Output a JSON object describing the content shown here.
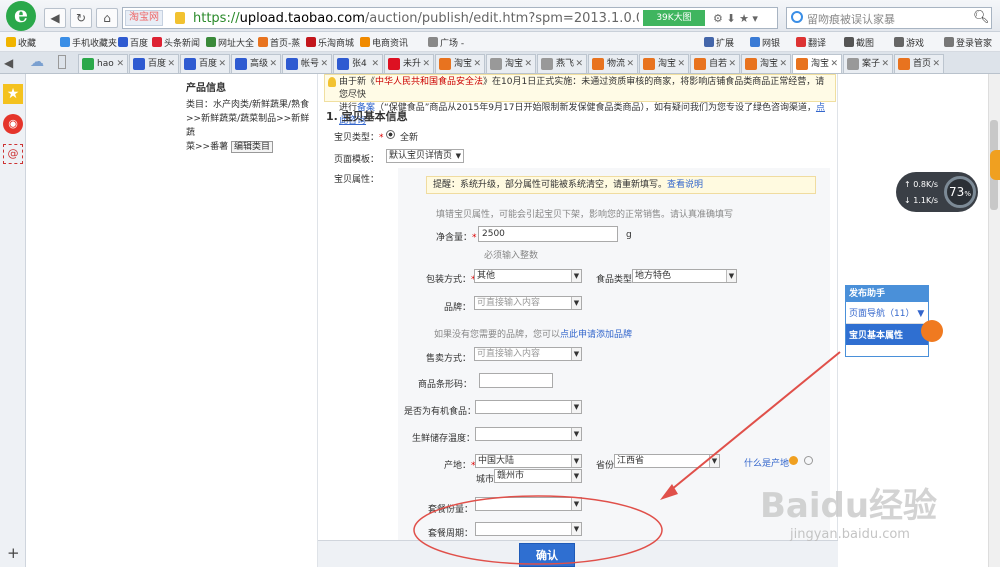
{
  "browser": {
    "site_badge": "淘宝网",
    "url_scheme": "https://",
    "url_host": "upload.taobao.com",
    "url_rest": "/auction/publish/edit.htm?spm=2013.1.0.0.Nm5Swi&item_nu",
    "green_badge": "39K大图",
    "search_placeholder": "留吻痕被误认家暴"
  },
  "favorites": [
    {
      "label": "收藏",
      "color": "#f0b400"
    },
    {
      "label": "手机收藏夹",
      "color": "#3a8ee6"
    },
    {
      "label": "百度",
      "color": "#2f5bd1"
    },
    {
      "label": "头条新闻",
      "color": "#d23"
    },
    {
      "label": "网址大全",
      "color": "#3a8a3a"
    },
    {
      "label": "首页-蒸",
      "color": "#e8731f"
    },
    {
      "label": "乐淘商城",
      "color": "#c3161c"
    },
    {
      "label": "电商资讯",
      "color": "#f08a00"
    },
    {
      "label": "广场 -",
      "color": "#888"
    }
  ],
  "favorites_right": [
    {
      "label": "扩展",
      "color": "#4466aa"
    },
    {
      "label": "网银",
      "color": "#3a7bd5"
    },
    {
      "label": "翻译",
      "color": "#d33"
    },
    {
      "label": "截图",
      "color": "#555"
    },
    {
      "label": "游戏",
      "color": "#666"
    },
    {
      "label": "登录管家",
      "color": "#777"
    }
  ],
  "tabs": [
    {
      "label": "hao",
      "color": "#2aa84a"
    },
    {
      "label": "百度",
      "color": "#2f5bd1"
    },
    {
      "label": "百度",
      "color": "#2f5bd1"
    },
    {
      "label": "高级",
      "color": "#2f5bd1"
    },
    {
      "label": "帐号",
      "color": "#2f5bd1"
    },
    {
      "label": "张4",
      "color": "#2f5bd1"
    },
    {
      "label": "未升",
      "color": "#d12"
    },
    {
      "label": "淘宝",
      "color": "#e8731f"
    },
    {
      "label": "淘宝",
      "color": "#999"
    },
    {
      "label": "燕飞",
      "color": "#999"
    },
    {
      "label": "物流",
      "color": "#e8731f"
    },
    {
      "label": "淘宝",
      "color": "#e8731f"
    },
    {
      "label": "自若",
      "color": "#e8731f"
    },
    {
      "label": "淘宝",
      "color": "#e8731f"
    },
    {
      "label": "淘宝",
      "color": "#e8731f"
    },
    {
      "label": "案子",
      "color": "#999"
    },
    {
      "label": "首页",
      "color": "#e8731f"
    }
  ],
  "left_panel": {
    "title": "产品信息",
    "category_lines": [
      "类目：水产肉类/新鲜蔬果/熟食",
      ">>新鲜蔬菜/蔬菜制品>>新鲜蔬",
      "菜>>番薯"
    ],
    "edit_link": "编辑类目"
  },
  "notice": {
    "line1_prefix": "由于新《",
    "line1_law": "中华人民共和国食品安全法",
    "line1_suffix": "》在10月1日正式实施：未通过资质审核的商家，将影响店铺食品类商品正常经营，请您尽快",
    "line2_a": "进行",
    "line2_link1": "备案",
    "line2_b": "（“保健食品”商品从2015年9月17日开始限制新发保健食品类商品），如有疑问我们为您专设了绿色咨询渠道，",
    "line2_link2": "点此咨询"
  },
  "form": {
    "section_title": "1. 宝贝基本信息",
    "item_type_label": "宝贝类型：",
    "item_type_value": "全新",
    "template_label": "页面模板：",
    "template_value": "默认宝贝详情页",
    "attr_label": "宝贝属性：",
    "tip_prefix": "提醒：系统升级，部分属性可能被系统清空，请重新填写。",
    "tip_link": "查看说明",
    "hint": "填错宝贝属性，可能会引起宝贝下架，影响您的正常销售。请认真准确填写",
    "net_label": "净含量：",
    "net_value": "2500",
    "net_unit": "g",
    "net_hint": "必须输入整数",
    "pack_label": "包装方式：",
    "pack_value": "其他",
    "food_type_label": "食品类型",
    "food_type_value": "地方特色",
    "brand_label": "品牌：",
    "brand_placeholder": "可直接输入内容",
    "brand_hint_prefix": "如果没有您需要的品牌，您可以",
    "brand_hint_link": "点此申请添加品牌",
    "sale_label": "售卖方式：",
    "sale_placeholder": "可直接输入内容",
    "barcode_label": "商品条形码：",
    "organic_label": "是否为有机食品：",
    "fresh_label": "生鲜储存温度：",
    "origin_label": "产地：",
    "origin_value": "中国大陆",
    "province_label": "省份",
    "province_value": "江西省",
    "city_label": "城市",
    "city_value": "赣州市",
    "what_origin": "什么是产地",
    "package_label": "套餐份量：",
    "period_label": "套餐周期：",
    "confirm": "确认"
  },
  "helper": {
    "title": "发布助手",
    "nav": "页面导航（11）",
    "current": "宝贝基本属性"
  },
  "speed": {
    "up": "0.8K/s",
    "down": "1.1K/s",
    "percent": "73"
  },
  "watermark": {
    "brand": "Baidu经验",
    "url": "jingyan.baidu.com"
  }
}
